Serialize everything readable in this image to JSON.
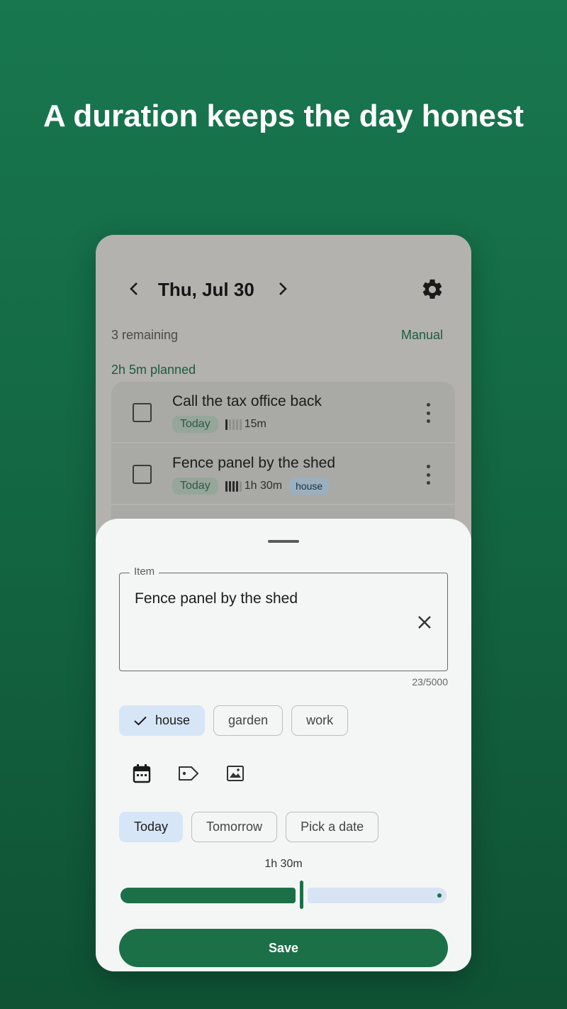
{
  "headline": "A duration keeps the day honest",
  "header": {
    "date": "Thu, Jul 30"
  },
  "summary": {
    "remaining": "3 remaining",
    "sort_mode": "Manual",
    "planned": "2h 5m planned"
  },
  "tasks": [
    {
      "title": "Call the tax office back",
      "when": "Today",
      "duration": "15m",
      "duration_level": 1,
      "tag": ""
    },
    {
      "title": "Fence panel by the shed",
      "when": "Today",
      "duration": "1h 30m",
      "duration_level": 4,
      "tag": "house"
    }
  ],
  "sheet": {
    "field_label": "Item",
    "field_value": "Fence panel by the shed",
    "counter": "23/5000",
    "tags": [
      {
        "label": "house",
        "selected": true
      },
      {
        "label": "garden",
        "selected": false
      },
      {
        "label": "work",
        "selected": false
      }
    ],
    "tools": [
      "calendar-icon",
      "tag-icon",
      "image-icon"
    ],
    "dates": [
      {
        "label": "Today",
        "selected": true
      },
      {
        "label": "Tomorrow",
        "selected": false
      },
      {
        "label": "Pick a date",
        "selected": false
      }
    ],
    "duration_label": "1h 30m",
    "duration_fraction": 0.55,
    "save_label": "Save"
  },
  "colors": {
    "primary": "#1b7048",
    "selected_chip": "#d7e6f6",
    "sheet_bg": "#f3f6f5"
  }
}
